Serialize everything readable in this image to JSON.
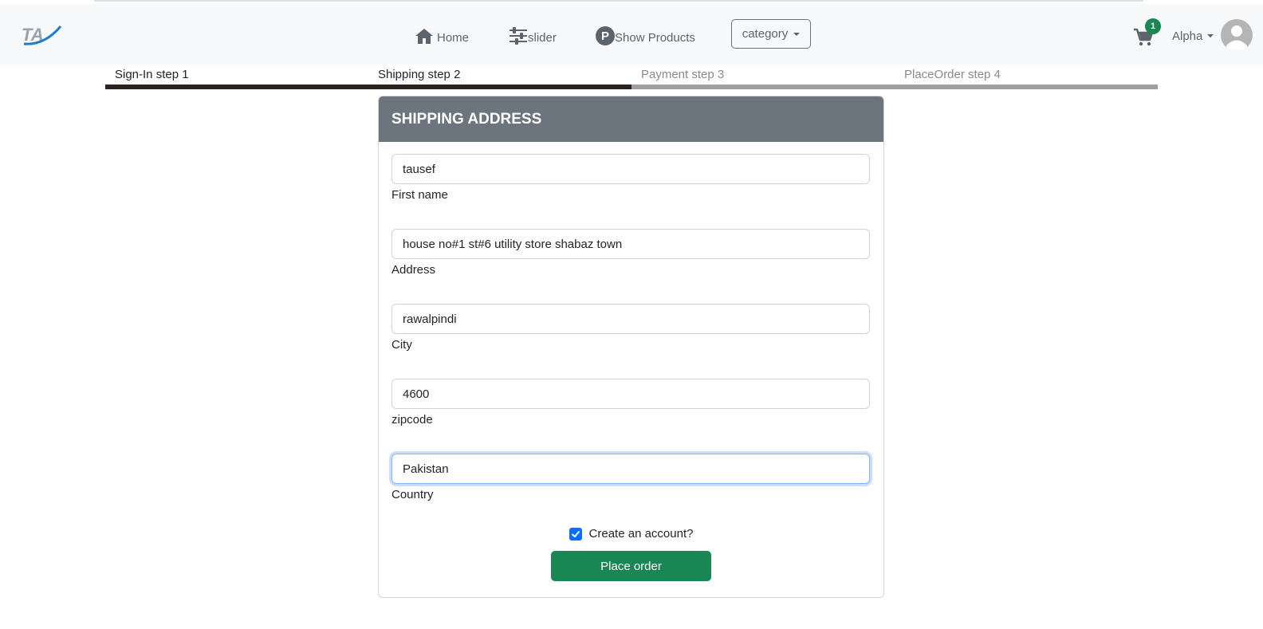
{
  "navbar": {
    "logo_text": "TA",
    "home_label": "Home",
    "slider_label": "slider",
    "products_icon_letter": "P",
    "products_label": "Show Products",
    "category_label": "category",
    "cart_count": "1",
    "user_name": "Alpha"
  },
  "steps": [
    {
      "label": "Sign-In step 1",
      "active": true
    },
    {
      "label": "Shipping step 2",
      "active": true
    },
    {
      "label": "Payment step 3",
      "active": false
    },
    {
      "label": "PlaceOrder step 4",
      "active": false
    }
  ],
  "form": {
    "title": "SHIPPING ADDRESS",
    "fields": [
      {
        "value": "tausef",
        "label": "First name"
      },
      {
        "value": "house no#1 st#6 utility store shabaz town",
        "label": "Address"
      },
      {
        "value": "rawalpindi",
        "label": "City"
      },
      {
        "value": "4600",
        "label": "zipcode"
      },
      {
        "value": "Pakistan",
        "label": "Country"
      }
    ],
    "create_account_label": "Create an account?",
    "create_account_checked": true,
    "submit_label": "Place order"
  },
  "colors": {
    "navbar_bg": "#f8f9fa",
    "card_header_bg": "#6c757d",
    "submit_bg": "#198754",
    "badge_bg": "#198754",
    "checkbox_bg": "#0d6efd"
  }
}
